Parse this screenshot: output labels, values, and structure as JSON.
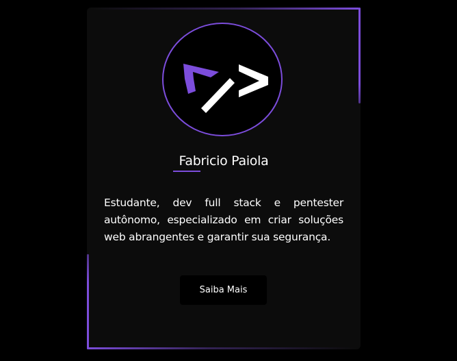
{
  "profile": {
    "logo_icon": "code-brackets-icon",
    "name": "Fabricio Paiola",
    "bio": "Estudante, dev full stack e pentester autônomo, especializado em criar soluções web abrangentes e garantir sua segurança.",
    "button_label": "Saiba Mais"
  },
  "colors": {
    "accent": "#7c4ddc",
    "card_background": "#0c0c0c",
    "page_background": "#000000",
    "text": "#ffffff"
  }
}
